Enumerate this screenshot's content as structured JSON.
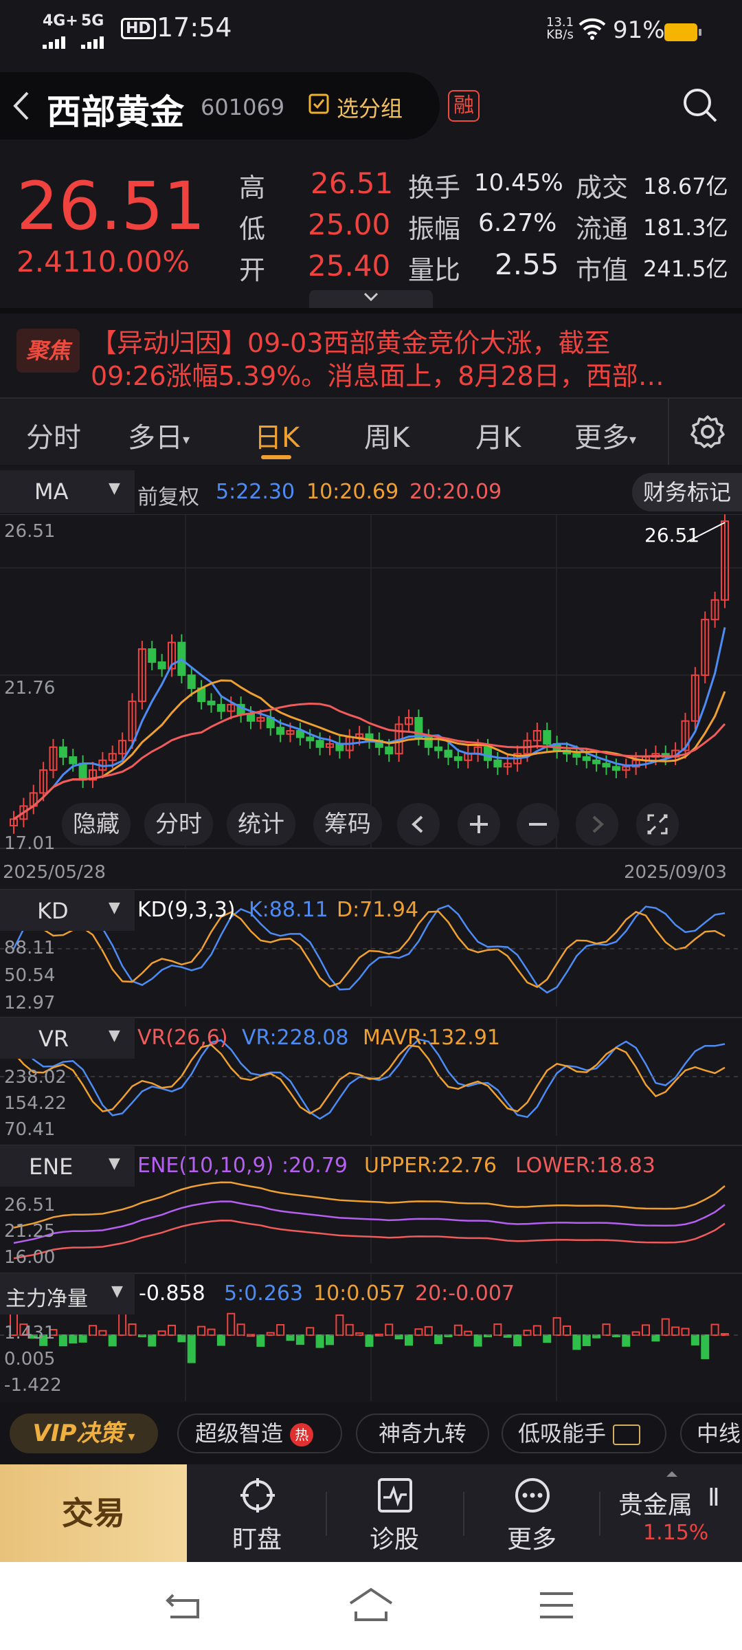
{
  "status": {
    "network": "4G+",
    "network2": "5G",
    "hd": "HD",
    "time": "17:54",
    "speed_value": "13.1",
    "speed_unit": "KB/s",
    "battery": "91%"
  },
  "header": {
    "stock_name": "西部黄金",
    "stock_code": "601069",
    "group_button": "选分组",
    "margin_badge": "融"
  },
  "quote": {
    "price": "26.51",
    "change": "2.41",
    "change_pct": "10.00%",
    "high_label": "高",
    "high_value": "26.51",
    "low_label": "低",
    "low_value": "25.00",
    "open_label": "开",
    "open_value": "25.40",
    "turnover_label": "换手",
    "turnover_value": "10.45%",
    "amplitude_label": "振幅",
    "amplitude_value": "6.27%",
    "volume_ratio_label": "量比",
    "volume_ratio_value": "2.55",
    "amount_label": "成交",
    "amount_value": "18.67亿",
    "float_label": "流通",
    "float_value": "181.3亿",
    "mktcap_label": "市值",
    "mktcap_value": "241.5亿"
  },
  "news": {
    "badge": "聚焦",
    "line1": "【异动归因】09-03西部黄金竞价大涨，截至",
    "line2": "09:26涨幅5.39%。消息面上，8月28日，西部…"
  },
  "tabs": [
    "分时",
    "多日",
    "日K",
    "周K",
    "月K",
    "更多"
  ],
  "active_tab": "日K",
  "main_chart": {
    "indicator": "MA",
    "adjust": "前复权",
    "ma5": "5:22.30",
    "ma10": "10:20.69",
    "ma20": "20:20.09",
    "finance_mark": "财务标记",
    "y_top": "26.51",
    "y_mid": "21.76",
    "y_bottom": "17.01",
    "last_label": "26.51",
    "date_start": "2025/05/28",
    "date_end": "2025/09/03",
    "controls": [
      "隐藏",
      "分时",
      "统计",
      "筹码"
    ]
  },
  "kd": {
    "name": "KD",
    "params": "KD(9,3,3)",
    "k": "K:88.11",
    "d": "D:71.94",
    "y1": "88.11",
    "y2": "50.54",
    "y3": "12.97"
  },
  "vr": {
    "name": "VR",
    "params": "VR(26,6)",
    "vr": "VR:228.08",
    "mavr": "MAVR:132.91",
    "y1": "238.02",
    "y2": "154.22",
    "y3": "70.41"
  },
  "ene": {
    "name": "ENE",
    "params": "ENE(10,10,9)",
    "mid": ":20.79",
    "upper": "UPPER:22.76",
    "lower": "LOWER:18.83",
    "y1": "26.51",
    "y2": "21.25",
    "y3": "16.00"
  },
  "flow": {
    "name": "主力净量",
    "value": "-0.858",
    "v5": "5:0.263",
    "v10": "10:0.057",
    "v20": "20:-0.007",
    "y1": "1.431",
    "y2": "0.005",
    "y3": "-1.422"
  },
  "strategy_bar": {
    "vip": "VIP决策",
    "items": [
      "超级智造",
      "神奇九转",
      "低吸能手",
      "中线"
    ],
    "hot_badge": "热"
  },
  "bottom_nav": {
    "trade": "交易",
    "items": [
      "盯盘",
      "诊股",
      "更多"
    ],
    "sector_name": "贵金属",
    "sector_change": "1.15%"
  },
  "colors": {
    "up": "#f0433f",
    "down": "#2fbf4a",
    "ma5": "#4d8cf5",
    "ma10": "#f0a030",
    "ma20": "#f25b5b",
    "accent": "#f0a030"
  }
}
